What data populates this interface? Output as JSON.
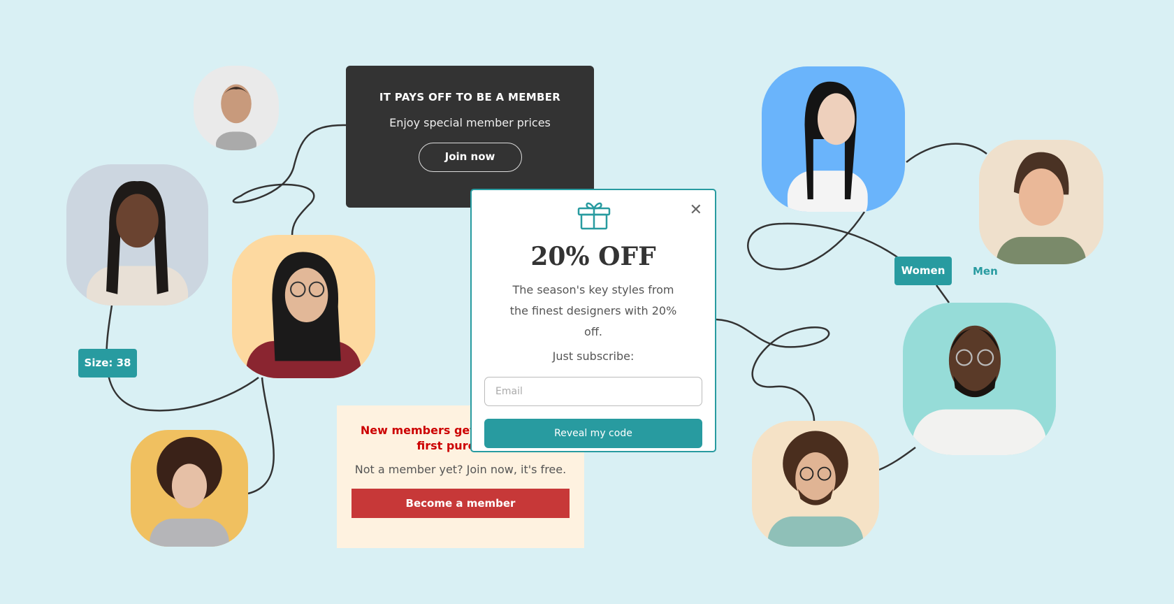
{
  "member_box": {
    "title": "IT PAYS OFF TO BE A MEMBER",
    "subtitle": "Enjoy special member prices",
    "button": "Join now"
  },
  "new_members_box": {
    "title": "New members get 10% off their first purchase",
    "text": "Not a member yet? Join now, it's free.",
    "button": "Become a member"
  },
  "popup": {
    "icon": "gift-icon",
    "title": "20% OFF",
    "description": "The season's key styles from the finest designers with 20% off.",
    "cta_text": "Just subscribe:",
    "email_placeholder": "Email",
    "button": "Reveal my code",
    "close_icon": "close-icon"
  },
  "size_badge": "Size: 38",
  "gender_filter": {
    "women": "Women",
    "men": "Men"
  },
  "colors": {
    "teal": "#289ba0",
    "dark": "#333333",
    "red": "#c73838",
    "background": "#d9f0f4"
  }
}
